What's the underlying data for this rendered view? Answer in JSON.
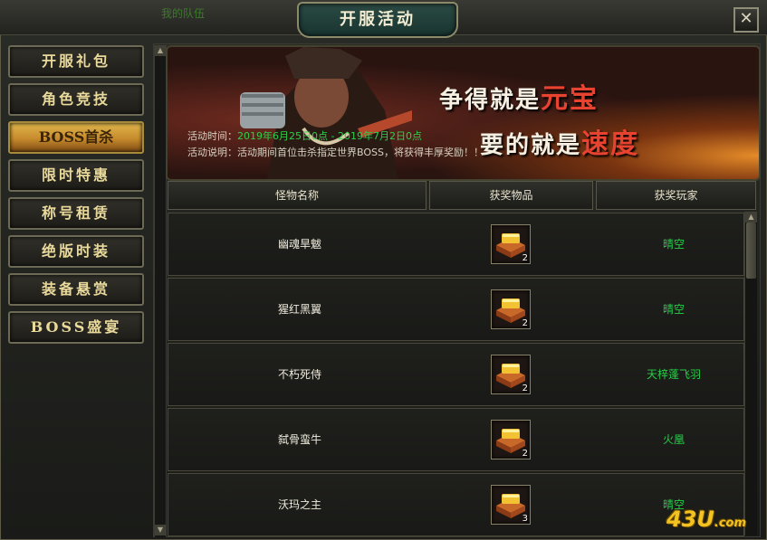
{
  "window": {
    "title": "开服活动",
    "team_label": "我的队伍",
    "close_label": "✕"
  },
  "sidebar": {
    "items": [
      {
        "label": "开服礼包",
        "active": false
      },
      {
        "label": "角色竞技",
        "active": false
      },
      {
        "label": "BOSS首杀",
        "active": true
      },
      {
        "label": "限时特惠",
        "active": false
      },
      {
        "label": "称号租赁",
        "active": false
      },
      {
        "label": "绝版时装",
        "active": false
      },
      {
        "label": "装备悬赏",
        "active": false
      },
      {
        "label": "BOSS盛宴",
        "active": false
      }
    ]
  },
  "banner": {
    "slogan_1_prefix": "争得就是",
    "slogan_1_highlight": "元宝",
    "slogan_2_prefix": "要的就是",
    "slogan_2_highlight": "速度",
    "time_label": "活动时间：",
    "time_value": "2019年6月25日0点 - 2019年7月2日0点",
    "desc_label": "活动说明：",
    "desc_value": "活动期间首位击杀指定世界BOSS，将获得丰厚奖励！！"
  },
  "table": {
    "headers": [
      "怪物名称",
      "获奖物品",
      "获奖玩家"
    ],
    "rows": [
      {
        "monster": "幽魂旱魃",
        "item_count": "2",
        "player": "晴空"
      },
      {
        "monster": "猩红黑翼",
        "item_count": "2",
        "player": "晴空"
      },
      {
        "monster": "不朽死侍",
        "item_count": "2",
        "player": "天梓蓬飞羽"
      },
      {
        "monster": "弑骨蛮牛",
        "item_count": "2",
        "player": "火凰"
      },
      {
        "monster": "沃玛之主",
        "item_count": "3",
        "player": "晴空"
      }
    ]
  },
  "watermark": {
    "main": "43U",
    "suffix": ".com"
  },
  "colors": {
    "accent_gold": "#e0b74c",
    "player_green": "#23d046",
    "slogan_red": "#e84230"
  },
  "icons": {
    "item": "gold-ingot-chest-icon",
    "close": "close-icon"
  }
}
